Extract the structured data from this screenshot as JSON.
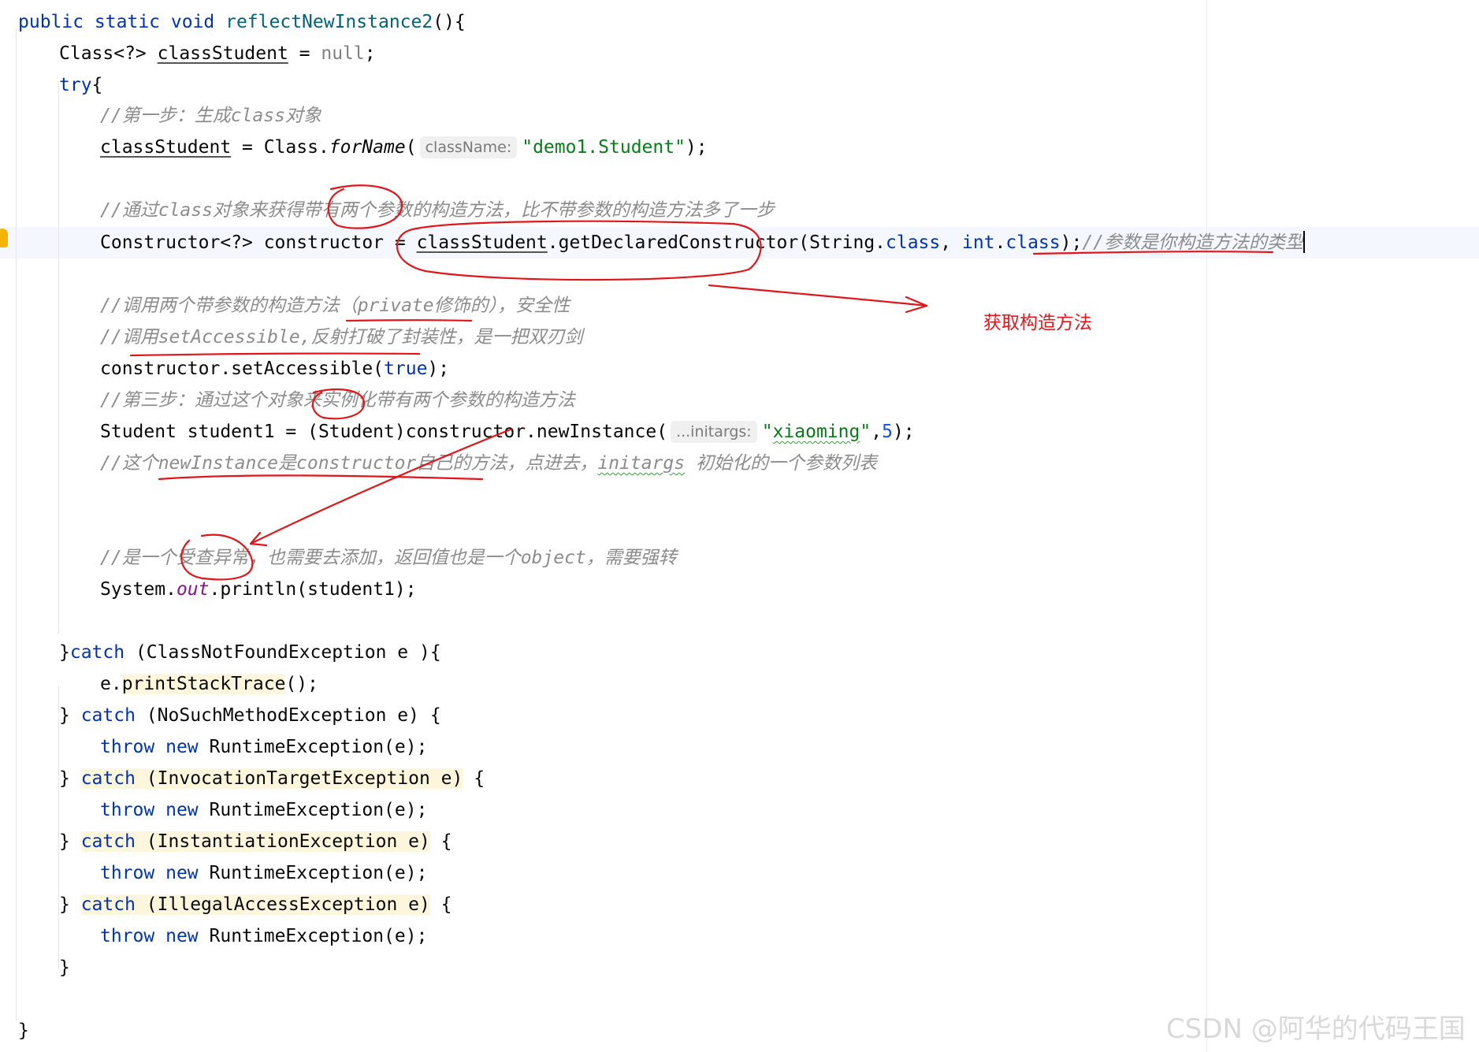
{
  "editor": {
    "method_signature": {
      "modifiers": "public static void",
      "name": "reflectNewInstance2",
      "params": "(){"
    },
    "l2": {
      "text_a": "Class<?> ",
      "var": "classStudent",
      "text_b": " = ",
      "null_kw": "null",
      "end": ";"
    },
    "l3": {
      "try_kw": "try",
      "brace": "{"
    },
    "l4": {
      "comment": "//第一步：生成class对象"
    },
    "l5": {
      "var": "classStudent",
      "text_a": " = Class.",
      "method": "forName",
      "paren": "(",
      "hint": "className:",
      "string": "\"demo1.Student\"",
      "end": ");"
    },
    "l6": {
      "comment": "//通过class对象来获得带有两个参数的构造方法，比不带参数的构造方法多了一步"
    },
    "l7": {
      "text_a": "Constructor<?> constructor = ",
      "var": "classStudent",
      "text_b": ".getDeclaredConstructor(String.",
      "class_kw1": "class",
      "text_c": ", ",
      "int_kw": "int",
      "dot": ".",
      "class_kw2": "class",
      "text_d": ");",
      "comment": "//参数是你构造方法的类型"
    },
    "l8": {
      "comment": "//调用两个带参数的构造方法（private修饰的），安全性"
    },
    "l9": {
      "comment": "//调用setAccessible,反射打破了封装性，是一把双刃剑"
    },
    "l10": {
      "text_a": "constructor.setAccessible(",
      "true_kw": "true",
      "end": ");"
    },
    "l11": {
      "comment": "//第三步：通过这个对象来实例化带有两个参数的构造方法"
    },
    "l12": {
      "text_a": "Student student1 = (Student)constructor.newInstance(",
      "hint": "...initargs:",
      "string_q1": "\"",
      "string_body": "xiaoming",
      "string_q2": "\"",
      "comma": ",",
      "number": "5",
      "end": ");"
    },
    "l13": {
      "comment_a": "//这个newInstance是constructor自己的方法，点进去，",
      "comment_b": "initargs",
      "comment_c": " 初始化的一个参数列表"
    },
    "l14": {
      "comment": "//是一个受查异常，也需要去添加，返回值也是一个object，需要强转"
    },
    "l15": {
      "text_a": "System.",
      "field": "out",
      "text_b": ".println(student1);"
    },
    "l16": {
      "brace": "}",
      "catch_kw": "catch",
      "text": " (ClassNotFoundException e ){"
    },
    "l17": {
      "text_a": "e.",
      "method": "printStackTrace",
      "text_b": "();"
    },
    "catch_blocks": [
      {
        "brace": "} ",
        "catch_kw": "catch",
        "text": " (NoSuchMethodException e)",
        "open": " {",
        "throw_kw": "throw",
        "new_kw": "new",
        "body": " RuntimeException(e);"
      },
      {
        "brace": "} ",
        "catch_kw": "catch",
        "text": " (InvocationTargetException e)",
        "open": " {",
        "throw_kw": "throw",
        "new_kw": "new",
        "body": " RuntimeException(e);"
      },
      {
        "brace": "} ",
        "catch_kw": "catch",
        "text": " (InstantiationException e)",
        "open": " {",
        "throw_kw": "throw",
        "new_kw": "new",
        "body": " RuntimeException(e);"
      },
      {
        "brace": "} ",
        "catch_kw": "catch",
        "text": " (IllegalAccessException e)",
        "open": " {",
        "throw_kw": "throw",
        "new_kw": "new",
        "body": " RuntimeException(e);"
      }
    ],
    "try_close": "}",
    "method_close": "}"
  },
  "annotation": {
    "note": "获取构造方法",
    "ink_color": "#e0161a"
  },
  "watermark": "CSDN @阿华的代码王国",
  "colors": {
    "keyword": "#0033b3",
    "string": "#067d17",
    "number": "#1750eb",
    "comment": "#8c8c8c",
    "field": "#871094",
    "highlight": "#fdf6dc"
  }
}
